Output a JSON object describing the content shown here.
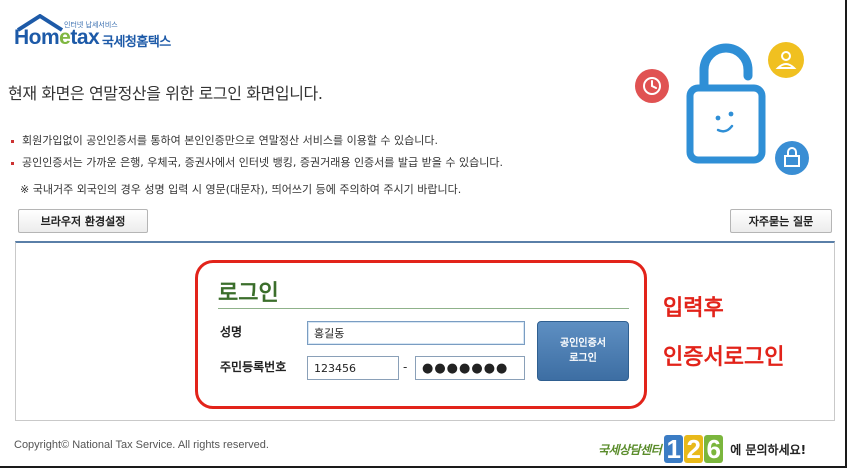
{
  "logo": {
    "tagline": "인터넷 납세서비스",
    "word_a": "Hom",
    "word_e": "e",
    "word_b": "tax",
    "name_kr": "국세청홈택스"
  },
  "intro": {
    "headline": "현재 화면은 연말정산을 위한 로그인 화면입니다.",
    "bullets": [
      "회원가입없이 공인인증서를 통하여 본인인증만으로 연말정산 서비스를 이용할 수 있습니다.",
      "공인인증서는 가까운 은행, 우체국, 증권사에서 인터넷 뱅킹, 증권거래용 인증서를 발급 받을 수 있습니다."
    ],
    "note": "※ 국내거주 외국인의 경우 성명 입력 시 영문(대문자), 띄어쓰기 등에 주의하여 주시기 바랍니다."
  },
  "buttons": {
    "browser_settings": "브라우저 환경설정",
    "faq": "자주묻는 질문"
  },
  "login": {
    "title": "로그인",
    "name_label": "성명",
    "name_value": "홍길동",
    "rrn_label": "주민등록번호",
    "rrn_front": "123456",
    "rrn_separator": "-",
    "rrn_back": "●●●●●●●",
    "cert_button_line1": "공인인증서",
    "cert_button_line2": "로그인"
  },
  "annotation": {
    "line1": "입력후",
    "line2": "인증서로그인"
  },
  "footer": {
    "copyright": "Copyright© National Tax Service. All rights reserved.",
    "callcenter_label": "국세상담센터",
    "callcenter_digits": [
      "1",
      "2",
      "6"
    ],
    "callcenter_tail": "에 문의하세요!"
  },
  "colors": {
    "brand_blue": "#1d5aa8",
    "login_green": "#3b6e2b",
    "annotation_red": "#e2231a",
    "lock_blue": "#2f8fd6"
  },
  "icons": [
    "home-roof-icon",
    "clock-icon",
    "user-icon",
    "unlock-icon",
    "padlock-illustration"
  ]
}
